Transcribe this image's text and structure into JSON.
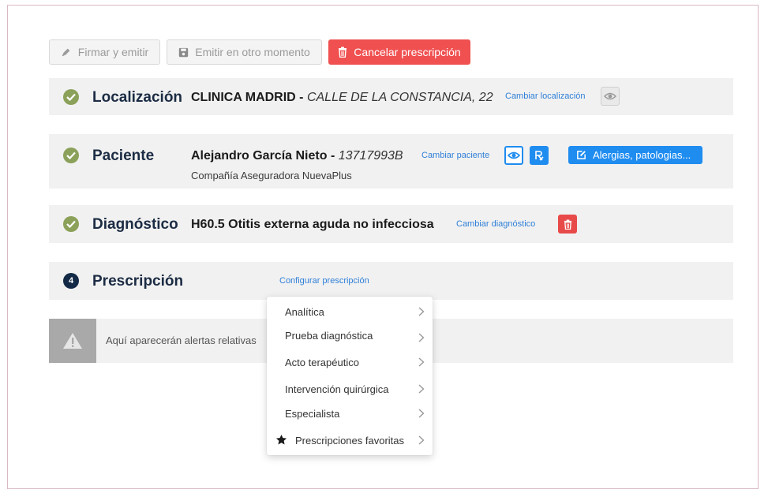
{
  "toolbar": {
    "sign_label": "Firmar y emitir",
    "later_label": "Emitir en otro momento",
    "cancel_label": "Cancelar prescripción"
  },
  "location": {
    "title": "Localización",
    "name": "CLINICA MADRID",
    "separator": " - ",
    "address": "CALLE DE LA CONSTANCIA, 22",
    "change_link": "Cambiar localización"
  },
  "patient": {
    "title": "Paciente",
    "name": "Alejandro García Nieto",
    "separator": " - ",
    "id": "13717993B",
    "change_link": "Cambiar paciente",
    "insurer": "Compañía Aseguradora NuevaPlus",
    "allergies_label": "Alergias, patologias..."
  },
  "diagnosis": {
    "title": "Diagnóstico",
    "value": "H60.5 Otitis externa aguda no infecciosa",
    "change_link": "Cambiar diagnóstico"
  },
  "prescription": {
    "step": "4",
    "title": "Prescripción",
    "configure_link": "Configurar prescripción"
  },
  "alert": {
    "text": "Aquí aparecerán alertas relativas"
  },
  "menu": {
    "items": [
      {
        "label": "Analítica"
      },
      {
        "label": "Prueba diagnóstica"
      },
      {
        "label": "Acto terapéutico"
      },
      {
        "label": "Intervención quirúrgica"
      },
      {
        "label": "Especialista"
      },
      {
        "label": "Prescripciones favoritas",
        "icon": "star-icon"
      }
    ]
  },
  "colors": {
    "danger": "#f05050",
    "check_green": "#8ba15a",
    "primary_blue": "#1f8cf0",
    "title_navy": "#1c2c44"
  }
}
